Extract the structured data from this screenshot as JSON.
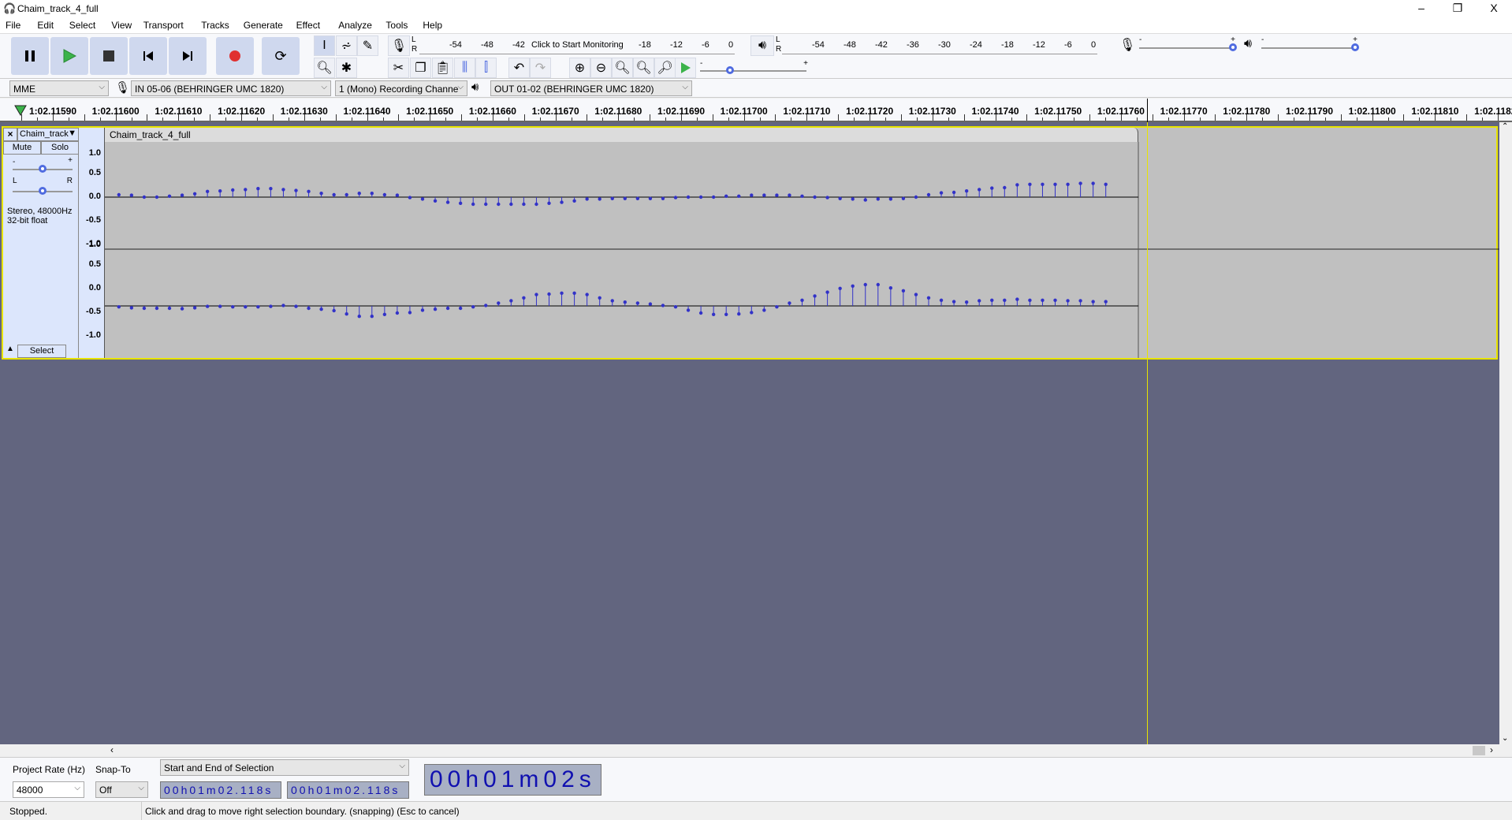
{
  "window": {
    "title": "Chaim_track_4_full",
    "minimize": "–",
    "restore": "❐",
    "close": "X"
  },
  "menu": [
    "File",
    "Edit",
    "Select",
    "View",
    "Transport",
    "Tracks",
    "Generate",
    "Effect",
    "Analyze",
    "Tools",
    "Help"
  ],
  "record_meter": {
    "lr": "L\nR",
    "ticks": [
      "-54",
      "-48",
      "-42",
      "-18",
      "-12",
      "-6",
      "0"
    ],
    "monitor_label": "Click to Start Monitoring"
  },
  "play_meter": {
    "lr": "L\nR",
    "ticks": [
      "-54",
      "-48",
      "-42",
      "-36",
      "-30",
      "-24",
      "-18",
      "-12",
      "-6",
      "0"
    ]
  },
  "mixer": {
    "minus": "-",
    "plus": "+",
    "input_volume": 1.0,
    "output_volume": 1.0
  },
  "play_at_speed": {
    "minus": "-",
    "plus": "+",
    "speed": 0.25
  },
  "devices": {
    "host": "MME",
    "input": "IN 05-06 (BEHRINGER UMC 1820)",
    "channels": "1 (Mono) Recording Channe",
    "output": "OUT 01-02 (BEHRINGER UMC 1820)"
  },
  "ruler": {
    "labels": [
      "1:02.11590",
      "1:02.11600",
      "1:02.11610",
      "1:02.11620",
      "1:02.11630",
      "1:02.11640",
      "1:02.11650",
      "1:02.11660",
      "1:02.11670",
      "1:02.11680",
      "1:02.11690",
      "1:02.11700",
      "1:02.11710",
      "1:02.11720",
      "1:02.11730",
      "1:02.11740",
      "1:02.11750",
      "1:02.11760",
      "1:02.11770",
      "1:02.11780",
      "1:02.11790",
      "1:02.11800",
      "1:02.11810",
      "1:02.11820"
    ]
  },
  "track": {
    "name": "Chaim_track",
    "clip_name": "Chaim_track_4_full",
    "mute": "Mute",
    "solo": "Solo",
    "gain_minus": "-",
    "gain_plus": "+",
    "pan_l": "L",
    "pan_r": "R",
    "info1": "Stereo, 48000Hz",
    "info2": "32-bit float",
    "select": "Select",
    "gain": 0.5,
    "pan": 0.5,
    "scale": [
      "1.0",
      "0.5",
      "0.0",
      "-0.5",
      "-1.0"
    ],
    "wave_color": "#3232c8",
    "selection_color": "#e8e400",
    "channel_left": [
      0.05,
      0.04,
      0,
      0,
      0.02,
      0.04,
      0.07,
      0.12,
      0.13,
      0.15,
      0.16,
      0.18,
      0.18,
      0.16,
      0.14,
      0.12,
      0.08,
      0.05,
      0.05,
      0.08,
      0.08,
      0.05,
      0.04,
      -0.01,
      -0.04,
      -0.08,
      -0.11,
      -0.13,
      -0.15,
      -0.15,
      -0.15,
      -0.15,
      -0.15,
      -0.15,
      -0.13,
      -0.11,
      -0.08,
      -0.04,
      -0.04,
      -0.03,
      -0.03,
      -0.03,
      -0.03,
      -0.03,
      -0.01,
      0,
      0,
      0,
      0.02,
      0.02,
      0.04,
      0.04,
      0.04,
      0.04,
      0.02,
      0,
      -0.01,
      -0.03,
      -0.04,
      -0.06,
      -0.04,
      -0.04,
      -0.03,
      0,
      0.05,
      0.09,
      0.1,
      0.13,
      0.16,
      0.19,
      0.2,
      0.26,
      0.27,
      0.27,
      0.27,
      0.27,
      0.29,
      0.29,
      0.27
    ],
    "channel_right": [
      -0.02,
      -0.04,
      -0.05,
      -0.05,
      -0.05,
      -0.06,
      -0.04,
      -0.01,
      -0.01,
      -0.02,
      -0.02,
      -0.02,
      -0.01,
      0.01,
      -0.01,
      -0.05,
      -0.07,
      -0.1,
      -0.17,
      -0.22,
      -0.22,
      -0.18,
      -0.15,
      -0.14,
      -0.09,
      -0.07,
      -0.05,
      -0.05,
      -0.02,
      0.01,
      0.06,
      0.11,
      0.17,
      0.24,
      0.25,
      0.27,
      0.27,
      0.24,
      0.17,
      0.11,
      0.08,
      0.06,
      0.04,
      0.01,
      -0.02,
      -0.09,
      -0.15,
      -0.18,
      -0.18,
      -0.17,
      -0.14,
      -0.09,
      -0.02,
      0.06,
      0.12,
      0.21,
      0.29,
      0.37,
      0.42,
      0.45,
      0.45,
      0.38,
      0.32,
      0.24,
      0.17,
      0.12,
      0.09,
      0.08,
      0.11,
      0.12,
      0.12,
      0.14,
      0.12,
      0.12,
      0.12,
      0.11,
      0.11,
      0.09,
      0.09
    ]
  },
  "selection_toolbar": {
    "rate_label": "Project Rate (Hz)",
    "snap_label": "Snap-To",
    "rate": "48000",
    "snap": "Off",
    "mode": "Start and End of Selection",
    "start": "00h01m02.118s",
    "end": "00h01m02.118s"
  },
  "time_display": "00h01m02s",
  "status": {
    "state": "Stopped.",
    "message": "Click and drag to move right selection boundary. (snapping) (Esc to cancel)"
  }
}
